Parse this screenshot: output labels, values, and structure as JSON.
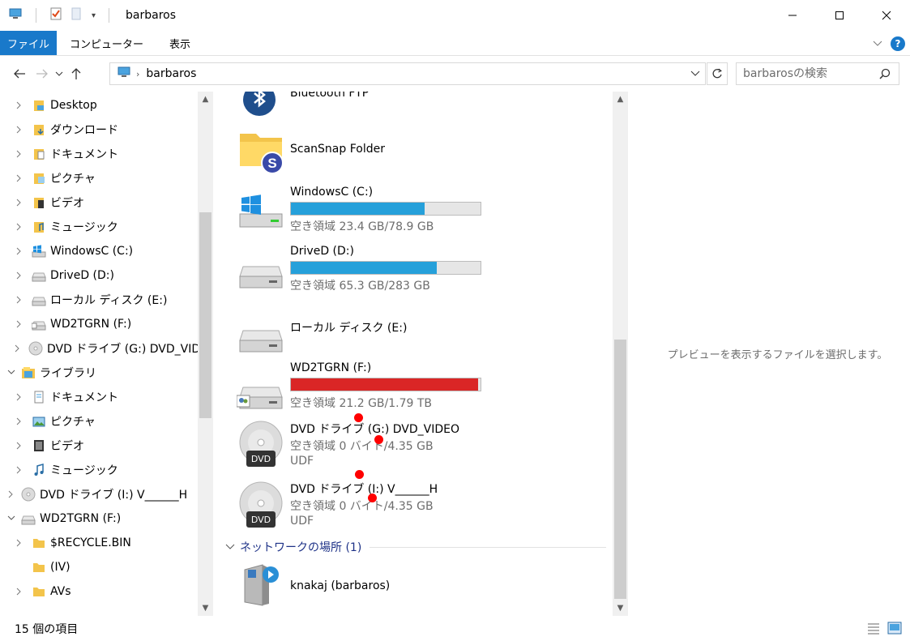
{
  "window": {
    "title": "barbaros",
    "controls": [
      "minimize-icon",
      "maximize-icon",
      "close-icon"
    ]
  },
  "ribbon": {
    "tabs": [
      "ファイル",
      "コンピューター",
      "表示"
    ],
    "help": "?"
  },
  "address": {
    "path": "barbaros",
    "search_placeholder": "barbarosの検索"
  },
  "nav": {
    "items": [
      {
        "label": "Desktop",
        "icon": "desktop-folder-icon",
        "level": 1
      },
      {
        "label": "ダウンロード",
        "icon": "downloads-folder-icon",
        "level": 1
      },
      {
        "label": "ドキュメント",
        "icon": "documents-folder-icon",
        "level": 1
      },
      {
        "label": "ピクチャ",
        "icon": "pictures-folder-icon",
        "level": 1
      },
      {
        "label": "ビデオ",
        "icon": "videos-folder-icon",
        "level": 1
      },
      {
        "label": "ミュージック",
        "icon": "music-folder-icon",
        "level": 1
      },
      {
        "label": "WindowsC (C:)",
        "icon": "windows-drive-icon",
        "level": 1
      },
      {
        "label": "DriveD (D:)",
        "icon": "drive-icon",
        "level": 1
      },
      {
        "label": "ローカル ディスク (E:)",
        "icon": "drive-icon",
        "level": 1
      },
      {
        "label": "WD2TGRN (F:)",
        "icon": "network-drive-icon",
        "level": 1
      },
      {
        "label": "DVD ドライブ (G:) DVD_VIDEO",
        "icon": "dvd-icon",
        "level": 1
      },
      {
        "label": "ライブラリ",
        "icon": "library-icon",
        "level": 0,
        "expanded": true
      },
      {
        "label": "ドキュメント",
        "icon": "documents-library-icon",
        "level": 1
      },
      {
        "label": "ピクチャ",
        "icon": "pictures-library-icon",
        "level": 1
      },
      {
        "label": "ビデオ",
        "icon": "videos-library-icon",
        "level": 1
      },
      {
        "label": "ミュージック",
        "icon": "music-library-icon",
        "level": 1
      },
      {
        "label": "DVD ドライブ (I:) V______H",
        "icon": "dvd-icon",
        "level": 0
      },
      {
        "label": "WD2TGRN (F:)",
        "icon": "drive-icon",
        "level": 0,
        "expanded": true
      },
      {
        "label": "$RECYCLE.BIN",
        "icon": "folder-icon",
        "level": 1
      },
      {
        "label": "(IV)",
        "icon": "folder-icon",
        "level": 1,
        "no_chevron": true
      },
      {
        "label": "AVs",
        "icon": "folder-icon",
        "level": 1
      }
    ]
  },
  "content": {
    "items": [
      {
        "name": "Bluetooth FTP",
        "icon": "bluetooth-icon"
      },
      {
        "name": "ScanSnap Folder",
        "icon": "scansnap-folder-icon"
      },
      {
        "name": "WindowsC (C:)",
        "sub": "空き領域 23.4 GB/78.9 GB",
        "usage": 0.703,
        "bar_color": "#26a0da",
        "icon": "windows-drive-icon"
      },
      {
        "name": "DriveD (D:)",
        "sub": "空き領域 65.3 GB/283 GB",
        "usage": 0.769,
        "bar_color": "#26a0da",
        "icon": "drive-icon"
      },
      {
        "name": "ローカル ディスク (E:)",
        "icon": "drive-icon"
      },
      {
        "name": "WD2TGRN (F:)",
        "sub": "空き領域 21.2 GB/1.79 TB",
        "usage": 0.988,
        "bar_color": "#da2626",
        "icon": "network-drive-icon"
      },
      {
        "name": "DVD ドライブ (G:) DVD_VIDEO",
        "sub": "空き領域 0 バイト/4.35 GB",
        "fs": "UDF",
        "icon": "dvd-icon",
        "badge": "DVD"
      },
      {
        "name": "DVD ドライブ (I:) V______H",
        "sub": "空き領域 0 バイト/4.35 GB",
        "fs": "UDF",
        "icon": "dvd-icon",
        "badge": "DVD"
      }
    ],
    "network_group": "ネットワークの場所 (1)",
    "network_items": [
      {
        "name": "knakaj (barbaros)",
        "icon": "media-server-icon"
      }
    ]
  },
  "preview": {
    "message": "プレビューを表示するファイルを選択します。"
  },
  "status": {
    "count": "15 個の項目"
  }
}
